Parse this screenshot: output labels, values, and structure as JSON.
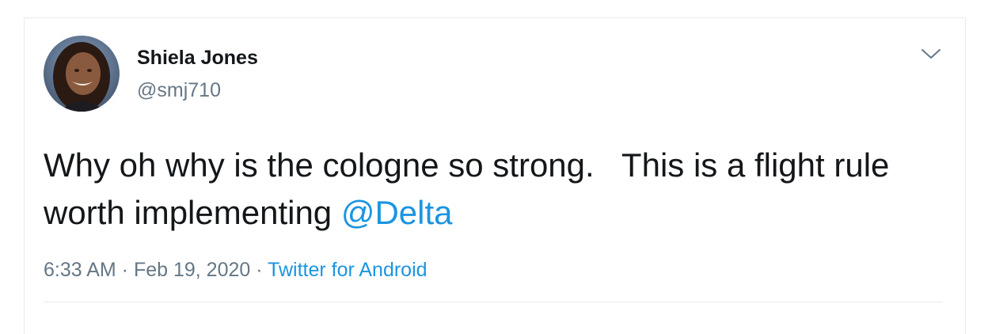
{
  "tweet": {
    "user": {
      "display_name": "Shiela Jones",
      "handle": "@smj710",
      "avatar_icon": "profile-photo"
    },
    "text_main": "Why oh why is the cologne so strong.   This is a flight rule worth implementing ",
    "mention": "@Delta",
    "time": "6:33 AM",
    "separator": " · ",
    "date": "Feb 19, 2020",
    "source": "Twitter for Android",
    "menu_icon": "chevron-down-icon"
  },
  "colors": {
    "text": "#14171a",
    "secondary": "#657786",
    "link": "#1b95e0",
    "border": "#e6ecf0"
  }
}
